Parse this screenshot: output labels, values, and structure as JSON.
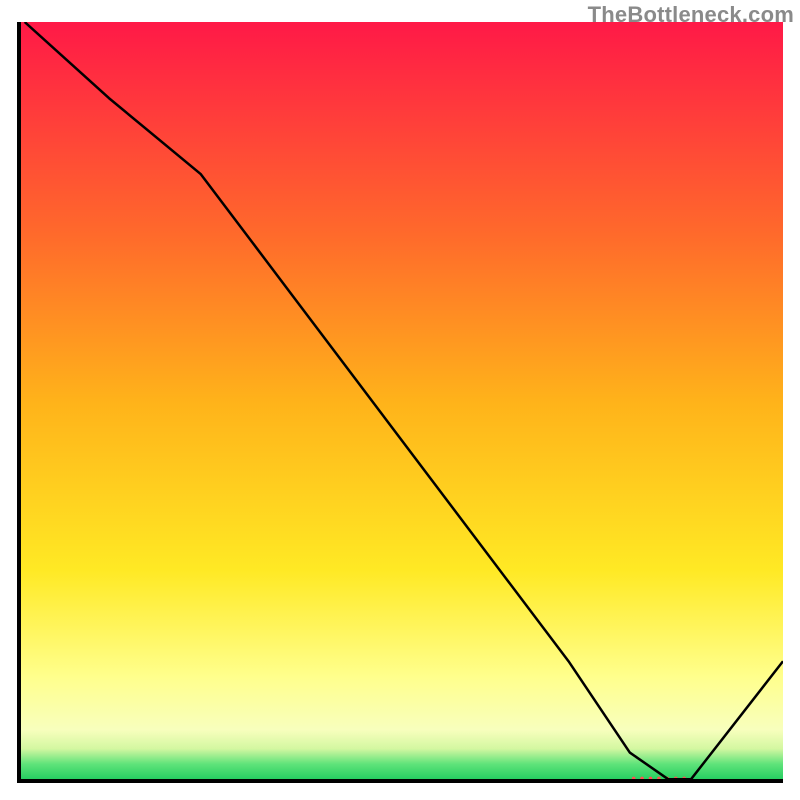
{
  "watermark": "TheBottleneck.com",
  "chart_data": {
    "type": "line",
    "title": "",
    "xlabel": "",
    "ylabel": "",
    "xlim": [
      0,
      100
    ],
    "ylim": [
      0,
      100
    ],
    "grid": false,
    "legend": false,
    "background": {
      "type": "vertical-gradient",
      "stops": [
        {
          "pos": 0.0,
          "color": "#ff1947"
        },
        {
          "pos": 0.28,
          "color": "#ff6a2b"
        },
        {
          "pos": 0.5,
          "color": "#ffb31a"
        },
        {
          "pos": 0.72,
          "color": "#ffe924"
        },
        {
          "pos": 0.86,
          "color": "#ffff8c"
        },
        {
          "pos": 0.93,
          "color": "#f8ffbd"
        },
        {
          "pos": 0.955,
          "color": "#d3f7a1"
        },
        {
          "pos": 0.975,
          "color": "#5fe37a"
        },
        {
          "pos": 1.0,
          "color": "#18c95b"
        }
      ]
    },
    "series": [
      {
        "name": "curve",
        "color": "#000000",
        "width": 2.5,
        "x": [
          1.0,
          12,
          24,
          36,
          48,
          60,
          72,
          80,
          85,
          88,
          100
        ],
        "y": [
          100,
          90,
          80,
          64,
          48,
          32,
          16,
          4,
          0.5,
          0.5,
          16
        ]
      }
    ],
    "markers": [
      {
        "name": "bottom-dotted-band",
        "type": "dotted-segment",
        "color": "#ff4f4f",
        "y": 0.6,
        "x_start": 80.5,
        "x_end": 87.5,
        "dot_radius": 1.8,
        "gap": 1.1
      }
    ]
  }
}
